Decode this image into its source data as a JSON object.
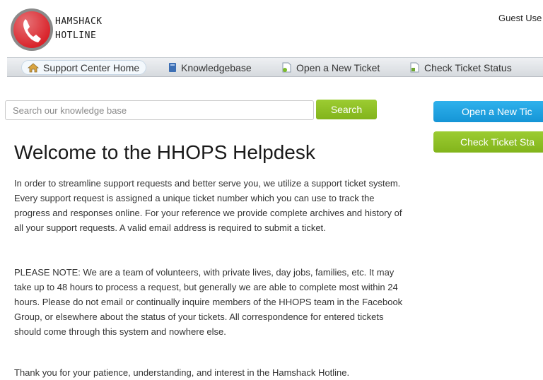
{
  "header": {
    "logo_line1": "HAMSHACK",
    "logo_line2": "HOTLINE",
    "user_label": "Guest Use"
  },
  "nav": {
    "items": [
      {
        "label": "Support Center Home",
        "icon": "home-icon"
      },
      {
        "label": "Knowledgebase",
        "icon": "book-icon"
      },
      {
        "label": "Open a New Ticket",
        "icon": "new-ticket-icon"
      },
      {
        "label": "Check Ticket Status",
        "icon": "ticket-status-icon"
      }
    ]
  },
  "search": {
    "placeholder": "Search our knowledge base",
    "value": "",
    "button_label": "Search"
  },
  "sidebar": {
    "open_ticket_label": "Open a New Tic",
    "check_status_label": "Check Ticket Sta"
  },
  "main": {
    "title": "Welcome to the HHOPS Helpdesk",
    "paragraph1": "In order to streamline support requests and better serve you, we utilize a support ticket system. Every support request is assigned a unique ticket number which you can use to track the progress and responses online. For your reference we provide complete archives and history of all your support requests. A valid email address is required to submit a ticket.",
    "paragraph2": "PLEASE NOTE: We are a team of volunteers, with private lives, day jobs, families, etc. It may take up to 48 hours to process a request, but generally we are able to complete most within 24 hours. Please do not email or continually inquire members of the HHOPS team in the Facebook Group, or elsewhere about the status of your tickets. All correspondence for entered tickets should come through this system and nowhere else.",
    "paragraph3": "Thank you for your patience, understanding, and interest in the Hamshack Hotline."
  },
  "colors": {
    "accent_green": "#8cc026",
    "accent_blue": "#1ea3e2",
    "logo_red": "#d9232a"
  }
}
